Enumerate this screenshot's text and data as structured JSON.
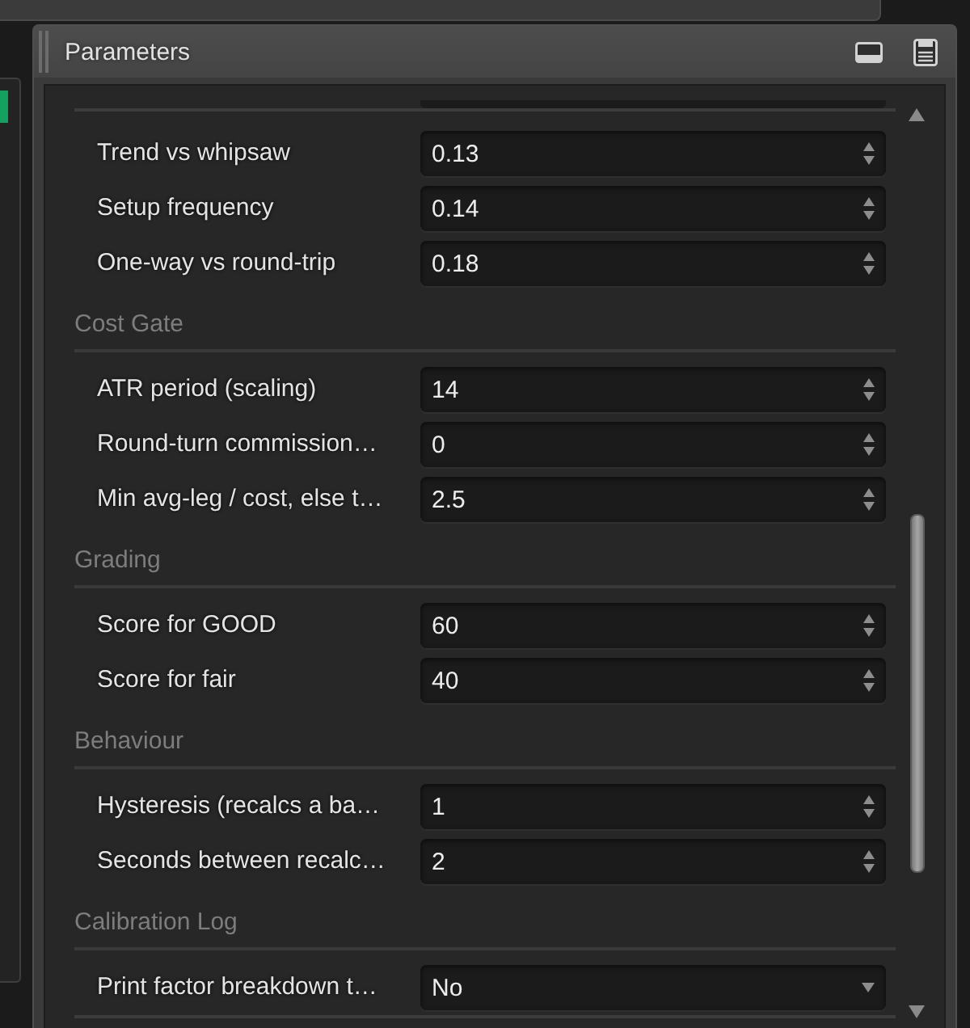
{
  "panel": {
    "title": "Parameters"
  },
  "sections": [
    {
      "rows": [
        {
          "label": "Trend vs whipsaw",
          "value": "0.13",
          "kind": "spinner"
        },
        {
          "label": "Setup frequency",
          "value": "0.14",
          "kind": "spinner"
        },
        {
          "label": "One-way vs round-trip",
          "value": "0.18",
          "kind": "spinner"
        }
      ]
    },
    {
      "title": "Cost Gate",
      "rows": [
        {
          "label": "ATR period (scaling)",
          "value": "14",
          "kind": "spinner"
        },
        {
          "label": "Round-turn commission…",
          "value": "0",
          "kind": "spinner"
        },
        {
          "label": "Min avg-leg / cost, else t…",
          "value": "2.5",
          "kind": "spinner"
        }
      ]
    },
    {
      "title": "Grading",
      "rows": [
        {
          "label": "Score for GOOD",
          "value": "60",
          "kind": "spinner"
        },
        {
          "label": "Score for fair",
          "value": "40",
          "kind": "spinner"
        }
      ]
    },
    {
      "title": "Behaviour",
      "rows": [
        {
          "label": "Hysteresis (recalcs a ba…",
          "value": "1",
          "kind": "spinner"
        },
        {
          "label": "Seconds between recalc…",
          "value": "2",
          "kind": "spinner"
        }
      ]
    },
    {
      "title": "Calibration Log",
      "rows": [
        {
          "label": "Print factor breakdown t…",
          "value": "No",
          "kind": "dropdown"
        }
      ]
    }
  ]
}
